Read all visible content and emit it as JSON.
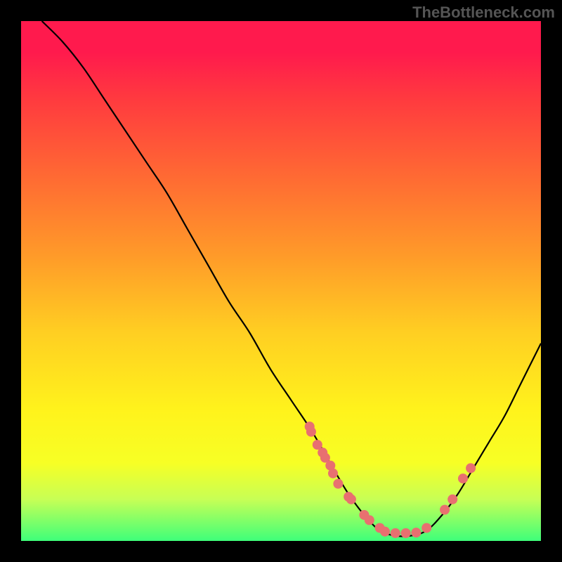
{
  "watermark": "TheBottleneck.com",
  "chart_data": {
    "type": "line",
    "title": "",
    "xlabel": "",
    "ylabel": "",
    "xlim": [
      0,
      100
    ],
    "ylim": [
      0,
      100
    ],
    "grid": false,
    "legend": false,
    "series": [
      {
        "name": "curve",
        "x": [
          4,
          8,
          12,
          16,
          20,
          24,
          28,
          32,
          36,
          40,
          44,
          48,
          52,
          56,
          60,
          63,
          66,
          69,
          72,
          75,
          78,
          81,
          84,
          87,
          90,
          93,
          96,
          100
        ],
        "values": [
          100,
          96,
          91,
          85,
          79,
          73,
          67,
          60,
          53,
          46,
          40,
          33,
          27,
          21,
          14,
          9,
          5,
          2,
          1,
          1,
          2,
          5,
          9,
          14,
          19,
          24,
          30,
          38
        ]
      }
    ],
    "markers": {
      "name": "data-points",
      "x_pct": [
        55.5,
        55.8,
        57.0,
        58.0,
        58.5,
        59.5,
        60.0,
        61.0,
        63.0,
        63.5,
        66.0,
        67.0,
        69.0,
        70.0,
        72.0,
        74.0,
        76.0,
        78.0,
        81.5,
        83.0,
        85.0,
        86.5
      ],
      "y_pct": [
        22.0,
        21.0,
        18.5,
        17.0,
        16.0,
        14.5,
        13.0,
        11.0,
        8.5,
        8.0,
        5.0,
        4.0,
        2.5,
        1.8,
        1.5,
        1.5,
        1.6,
        2.5,
        6.0,
        8.0,
        12.0,
        14.0
      ],
      "radius_pct": 0.95
    },
    "background_gradient": {
      "top": "#ff1a4d",
      "mid": "#fff31c",
      "bottom": "#3eff7a"
    }
  }
}
